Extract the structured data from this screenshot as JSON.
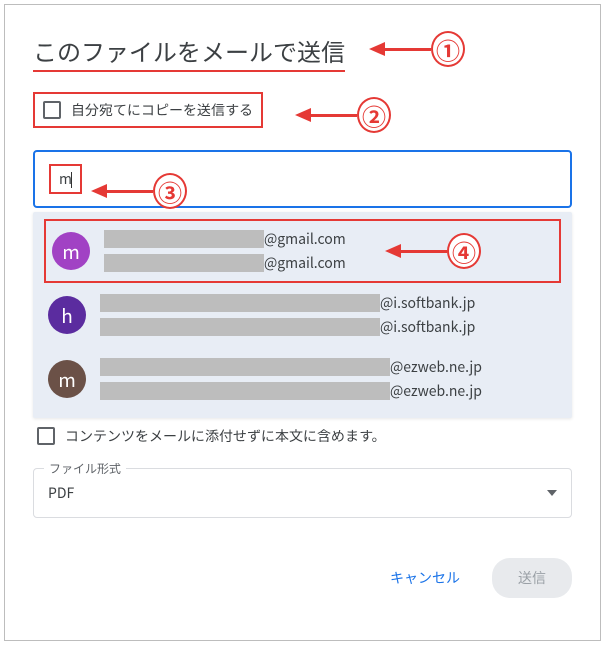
{
  "dialog": {
    "title": "このファイルをメールで送信",
    "copy_self_label": "自分宛てにコピーを送信する",
    "email_input_value": "m",
    "suggestions": [
      {
        "avatar_letter": "m",
        "avatar_color": "purple",
        "domain1": "@gmail.com",
        "domain2": "@gmail.com"
      },
      {
        "avatar_letter": "h",
        "avatar_color": "darkpurple",
        "domain1": "@i.softbank.jp",
        "domain2": "@i.softbank.jp"
      },
      {
        "avatar_letter": "m",
        "avatar_color": "brown",
        "domain1": "@ezweb.ne.jp",
        "domain2": "@ezweb.ne.jp"
      }
    ],
    "include_in_body_label": "コンテンツをメールに添付せずに本文に含めます。",
    "file_format_label": "ファイル形式",
    "file_format_value": "PDF",
    "cancel_label": "キャンセル",
    "send_label": "送信"
  },
  "callouts": {
    "n1": "①",
    "n2": "②",
    "n3": "③",
    "n4": "④"
  }
}
